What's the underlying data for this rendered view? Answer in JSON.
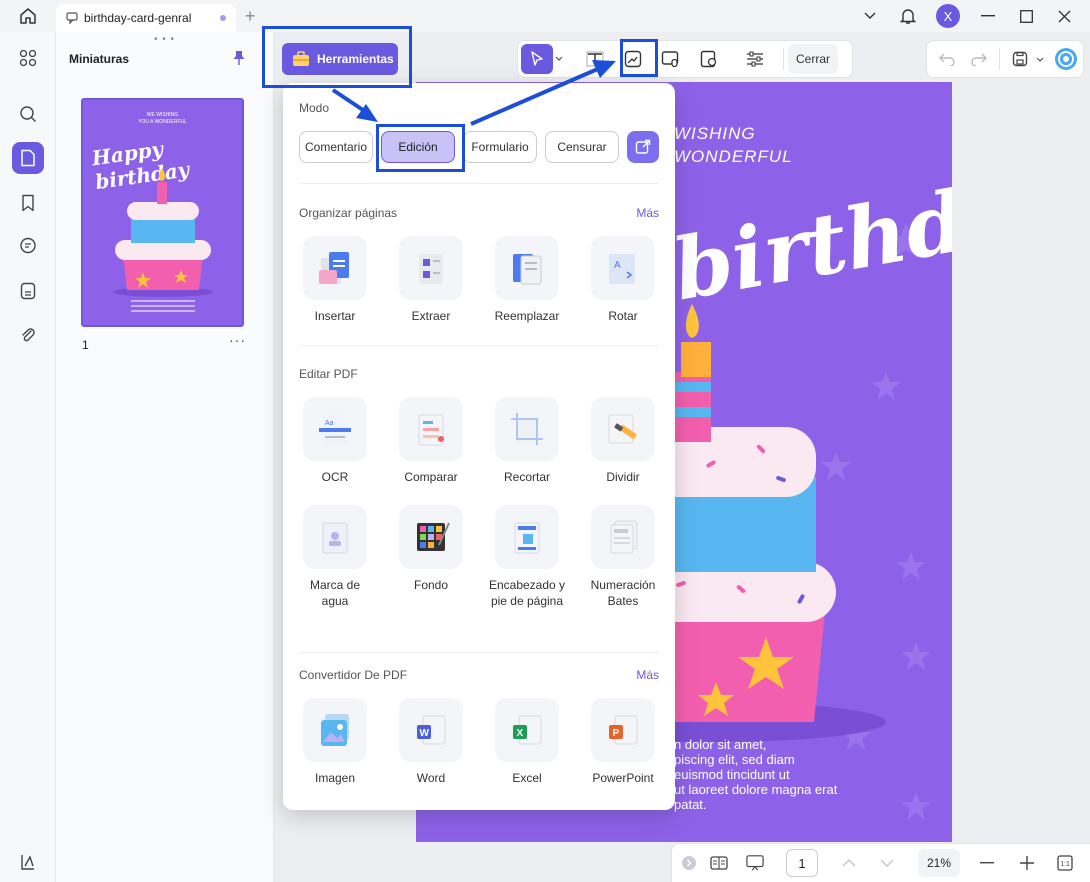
{
  "tab": {
    "title": "birthday-card-genral"
  },
  "user": {
    "initial": "X"
  },
  "thumbnails": {
    "title": "Miniaturas",
    "page_number": "1",
    "thumb_text": {
      "line1": "WE WISHING",
      "line2": "YOU A WONDERFUL",
      "script": "Happy birthday"
    }
  },
  "toolbar": {
    "tools_label": "Herramientas",
    "close_label": "Cerrar"
  },
  "popup": {
    "mode_title": "Modo",
    "modes": [
      "Comentario",
      "Edición",
      "Formulario",
      "Censurar"
    ],
    "organize": {
      "title": "Organizar páginas",
      "more": "Más",
      "items": [
        "Insertar",
        "Extraer",
        "Reemplazar",
        "Rotar"
      ]
    },
    "edit": {
      "title": "Editar PDF",
      "items": [
        "OCR",
        "Comparar",
        "Recortar",
        "Dividir",
        "Marca de agua",
        "Fondo",
        "Encabezado y pie de página",
        "Numeración Bates"
      ]
    },
    "convert": {
      "title": "Convertidor De PDF",
      "more": "Más",
      "items": [
        "Imagen",
        "Word",
        "Excel",
        "PowerPoint"
      ]
    }
  },
  "page": {
    "wishing_line1": "WISHING",
    "wishing_line2": "WONDERFUL",
    "script": "birthday",
    "lorem": [
      "n dolor sit amet,",
      "piscing elit, sed diam",
      "euismod tincidunt ut",
      "ut laoreet dolore magna erat",
      "patat."
    ]
  },
  "bottom": {
    "page_value": "1",
    "zoom": "21%"
  },
  "colors": {
    "accent": "#6a5ae0",
    "highlight": "#1b4fd8",
    "page_bg": "#8e62e8"
  }
}
